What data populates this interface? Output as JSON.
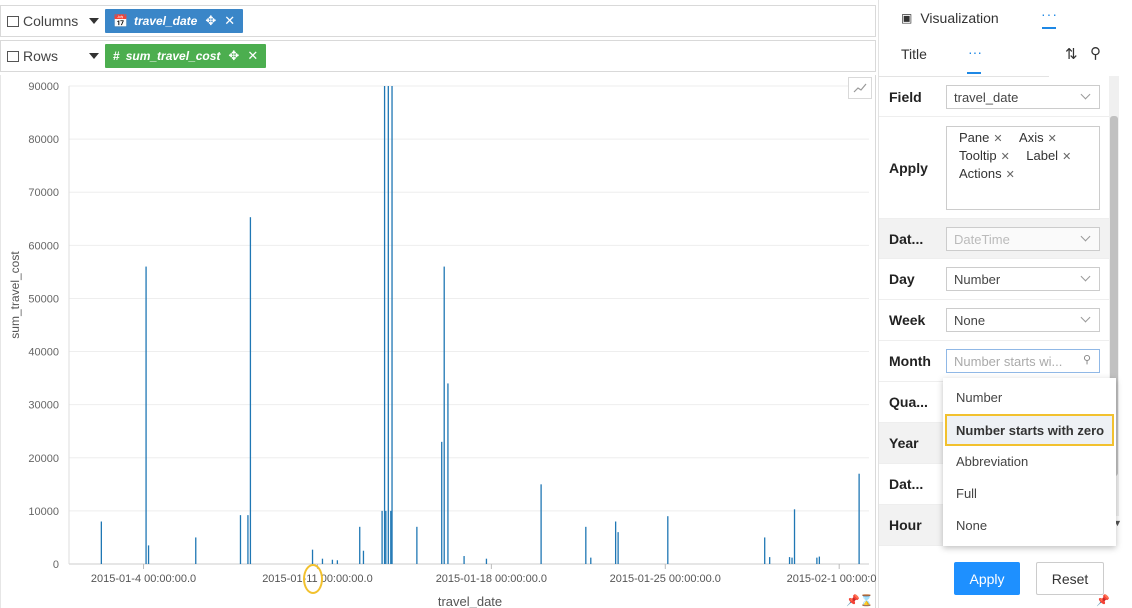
{
  "shelves": {
    "columns_label": "Columns",
    "rows_label": "Rows",
    "column_pill": "travel_date",
    "row_pill": "sum_travel_cost",
    "column_pill_color": "#3a86c8",
    "row_pill_color": "#4cae4f"
  },
  "chart_data": {
    "type": "bar",
    "xlabel": "travel_date",
    "ylabel": "sum_travel_cost",
    "ylim": [
      0,
      90000
    ],
    "y_ticks": [
      "90000",
      "80000",
      "70000",
      "60000",
      "50000",
      "40000",
      "30000",
      "20000",
      "10000",
      "0"
    ],
    "x_ticks": [
      "2015-01-4 00:00:00.0",
      "2015-01-11 00:00:00.0",
      "2015-01-18 00:00:00.0",
      "2015-01-25 00:00:00.0",
      "2015-02-1 00:00:00.0"
    ],
    "x_tick_days": [
      3,
      10,
      17,
      24,
      31
    ],
    "series": [
      {
        "color": "#1f77b4",
        "points": [
          {
            "day": 1.3,
            "value": 8000
          },
          {
            "day": 3.1,
            "value": 56000
          },
          {
            "day": 3.2,
            "value": 3500
          },
          {
            "day": 5.1,
            "value": 5000
          },
          {
            "day": 6.9,
            "value": 9200
          },
          {
            "day": 7.2,
            "value": 9200
          },
          {
            "day": 7.3,
            "value": 65300
          },
          {
            "day": 9.8,
            "value": 2700
          },
          {
            "day": 10.2,
            "value": 1000
          },
          {
            "day": 10.6,
            "value": 800
          },
          {
            "day": 10.8,
            "value": 700
          },
          {
            "day": 11.7,
            "value": 7000
          },
          {
            "day": 11.85,
            "value": 2500
          },
          {
            "day": 12.6,
            "value": 10000
          },
          {
            "day": 12.7,
            "value": 90000
          },
          {
            "day": 12.75,
            "value": 10000
          },
          {
            "day": 12.85,
            "value": 90000
          },
          {
            "day": 12.95,
            "value": 10000
          },
          {
            "day": 13.0,
            "value": 90000
          },
          {
            "day": 14.0,
            "value": 7000
          },
          {
            "day": 15.0,
            "value": 23000
          },
          {
            "day": 15.1,
            "value": 56000
          },
          {
            "day": 15.25,
            "value": 34000
          },
          {
            "day": 15.9,
            "value": 1500
          },
          {
            "day": 16.8,
            "value": 1000
          },
          {
            "day": 19.0,
            "value": 15000
          },
          {
            "day": 20.8,
            "value": 7000
          },
          {
            "day": 21.0,
            "value": 1200
          },
          {
            "day": 22.0,
            "value": 8000
          },
          {
            "day": 22.1,
            "value": 6000
          },
          {
            "day": 24.1,
            "value": 9000
          },
          {
            "day": 28.0,
            "value": 5000
          },
          {
            "day": 28.2,
            "value": 1300
          },
          {
            "day": 29.0,
            "value": 1300
          },
          {
            "day": 29.1,
            "value": 1200
          },
          {
            "day": 29.2,
            "value": 10300
          },
          {
            "day": 30.1,
            "value": 1200
          },
          {
            "day": 30.2,
            "value": 1400
          },
          {
            "day": 31.8,
            "value": 17000
          }
        ]
      }
    ]
  },
  "panel": {
    "viz_tab": "Visualization",
    "viz_more": "···",
    "title_tab": "Title",
    "sub_more": "···",
    "rows": {
      "field_label": "Field",
      "field_value": "travel_date",
      "apply_label": "Apply",
      "apply_chips": [
        "Pane",
        "Axis",
        "Tooltip",
        "Label",
        "Actions"
      ],
      "dat_label": "Dat...",
      "dat_value": "DateTime",
      "day_label": "Day",
      "day_value": "Number",
      "week_label": "Week",
      "week_value": "None",
      "month_label": "Month",
      "month_value": "Number starts wi...",
      "quarter_label": "Qua...",
      "year_label": "Year",
      "dat2_label": "Dat...",
      "hour_label": "Hour"
    },
    "dropdown_options": [
      "Number",
      "Number starts with zero",
      "Abbreviation",
      "Full",
      "None"
    ],
    "dropdown_selected": "Number starts with zero",
    "apply_button": "Apply",
    "reset_button": "Reset",
    "accent_color": "#1e90ff",
    "highlight_color": "#f2c12e"
  }
}
